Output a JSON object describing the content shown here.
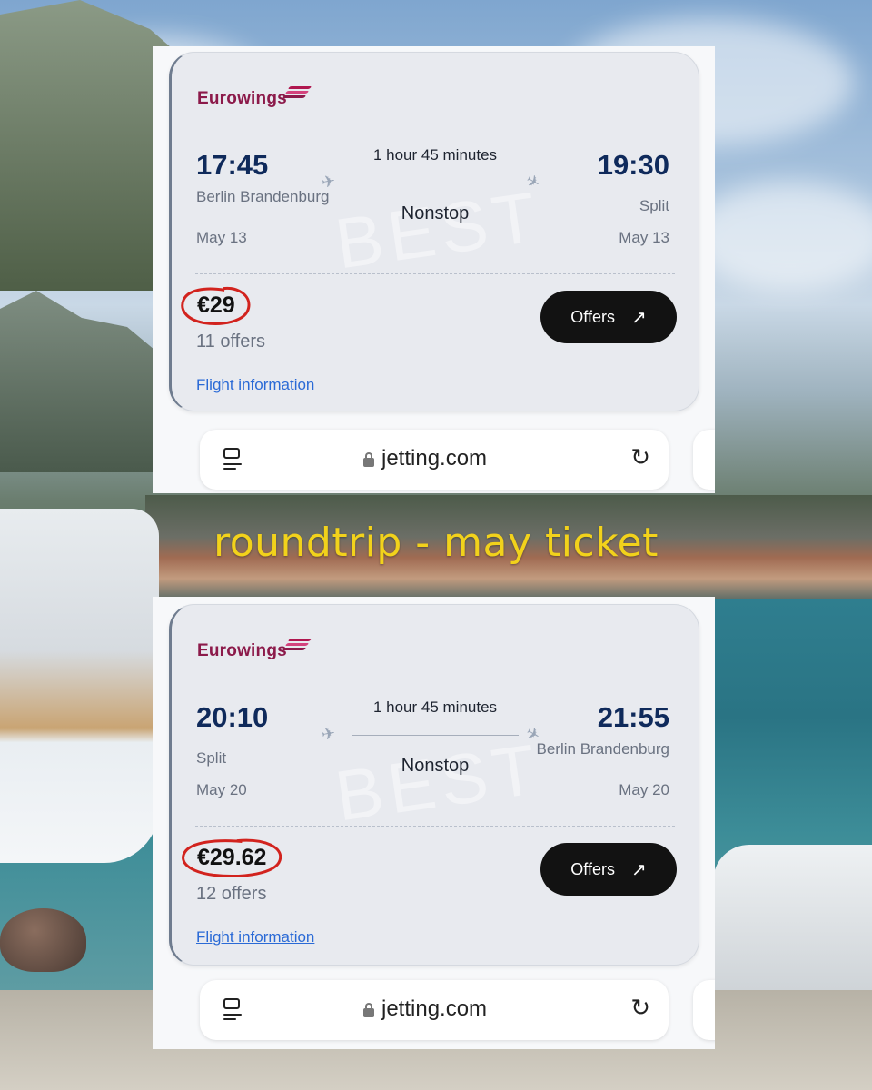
{
  "caption": "roundtrip - may ticket",
  "colors": {
    "airline_brand": "#8c1a4a",
    "time_text": "#0f2a5b",
    "offers_button": "#121212",
    "link": "#2a6ad6",
    "caption": "#f2d21b",
    "price_circle": "#d2231e"
  },
  "browser": {
    "url": "jetting.com",
    "tabs_icon": "tabs-icon",
    "lock_icon": "lock-icon",
    "reload_icon": "reload-icon"
  },
  "flights": [
    {
      "airline": "Eurowings",
      "departure": {
        "time": "17:45",
        "place": "Berlin Brandenburg",
        "date": "May 13"
      },
      "arrival": {
        "time": "19:30",
        "place": "Split",
        "date": "May 13"
      },
      "duration": "1 hour 45 minutes",
      "stops": "Nonstop",
      "badge_watermark": "BEST",
      "price": "€29",
      "offers_count": "11 offers",
      "offers_button": "Offers",
      "flight_info_link": "Flight information"
    },
    {
      "airline": "Eurowings",
      "departure": {
        "time": "20:10",
        "place": "Split",
        "date": "May 20"
      },
      "arrival": {
        "time": "21:55",
        "place": "Berlin Brandenburg",
        "date": "May 20"
      },
      "duration": "1 hour 45 minutes",
      "stops": "Nonstop",
      "badge_watermark": "BEST",
      "price": "€29.62",
      "offers_count": "12 offers",
      "offers_button": "Offers",
      "flight_info_link": "Flight information"
    }
  ]
}
